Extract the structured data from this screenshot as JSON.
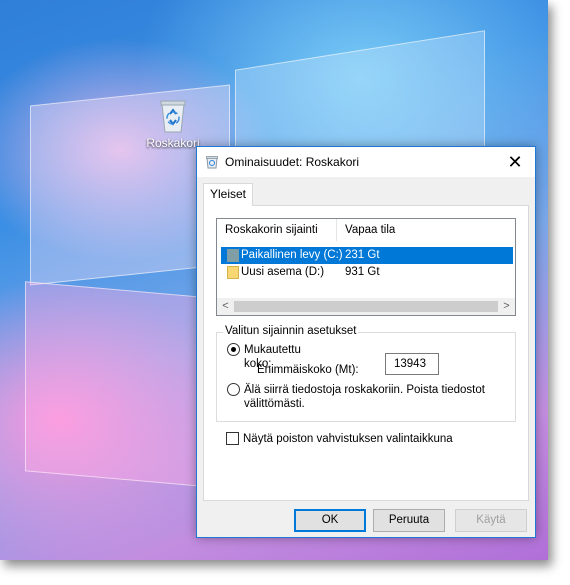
{
  "desktop": {
    "icon_label": "Roskakori",
    "icon_name": "recycle-bin-icon"
  },
  "dialog": {
    "title": "Ominaisuudet: Roskakori",
    "close_glyph": "✕",
    "tabs": [
      {
        "label": "Yleiset",
        "selected": true
      }
    ],
    "list": {
      "columns": [
        "Roskakorin sijainti",
        "Vapaa tila"
      ],
      "rows": [
        {
          "name": "Paikallinen levy (C:)",
          "free": "231 Gt",
          "selected": true,
          "icon": "drive-icon"
        },
        {
          "name": "Uusi asema (D:)",
          "free": "931 Gt",
          "selected": false,
          "icon": "folder-drive-icon"
        }
      ],
      "scroll_left": "<",
      "scroll_right": ">"
    },
    "settings": {
      "legend": "Valitun sijainnin asetukset",
      "custom_size_label": "Mukautettu koko:",
      "custom_size_selected": true,
      "max_size_label": "Enimmäiskoko (Mt):",
      "max_size_value": "13943",
      "no_move_label": "Älä siirrä tiedostoja roskakoriin. Poista tiedostot välittömästi."
    },
    "confirm_delete_label": "Näytä poiston vahvistuksen valintaikkuna",
    "confirm_delete_checked": false,
    "buttons": {
      "ok": "OK",
      "cancel": "Peruuta",
      "apply": "Käytä"
    }
  },
  "colors": {
    "accent": "#0078d7",
    "selection_text": "#ffffff",
    "disabled_text": "#a0a0a0"
  }
}
